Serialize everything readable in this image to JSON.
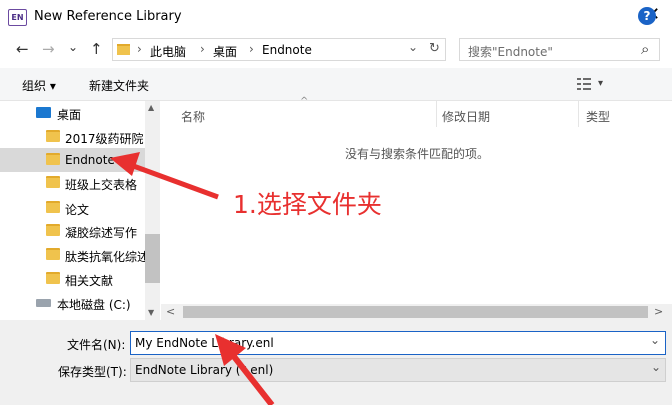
{
  "window": {
    "title": "New Reference Library",
    "app_icon": "EN",
    "close": "✕"
  },
  "address": {
    "back": "←",
    "forward": "→",
    "recent": "⌄",
    "up": "↑",
    "crumbs": [
      "此电脑",
      "桌面",
      "Endnote"
    ],
    "separator": "›",
    "dropdown": "⌄",
    "refresh": "↻"
  },
  "search": {
    "placeholder": "搜索\"Endnote\"",
    "icon": "⌕"
  },
  "toolbar": {
    "organize": "组织 ▾",
    "new_folder": "新建文件夹",
    "view_menu": "▾",
    "help": "?"
  },
  "nav": {
    "items": [
      {
        "label": "桌面",
        "selected": false,
        "type": "desktop"
      },
      {
        "label": "2017级药研院",
        "selected": false,
        "type": "folder"
      },
      {
        "label": "Endnote",
        "selected": true,
        "type": "folder"
      },
      {
        "label": "班级上交表格",
        "selected": false,
        "type": "folder"
      },
      {
        "label": "论文",
        "selected": false,
        "type": "folder"
      },
      {
        "label": "凝胶综述写作",
        "selected": false,
        "type": "folder"
      },
      {
        "label": "肽类抗氧化综述",
        "selected": false,
        "type": "folder"
      },
      {
        "label": "相关文献",
        "selected": false,
        "type": "folder"
      },
      {
        "label": "本地磁盘 (C:)",
        "selected": false,
        "type": "drive"
      }
    ],
    "scroll_up": "▲",
    "scroll_down": "▼"
  },
  "filelist": {
    "columns": [
      "名称",
      "修改日期",
      "类型"
    ],
    "sort_indicator": "^",
    "empty_message": "没有与搜索条件匹配的项。",
    "scroll_left": "<",
    "scroll_right": ">"
  },
  "form": {
    "filename_label": "文件名(N):",
    "filename_value": "My EndNote Library.enl",
    "savetype_label": "保存类型(T):",
    "savetype_value": "EndNote Library (*.enl)",
    "chevron": "⌄"
  },
  "annotation": {
    "text": "1.选择文件夹",
    "color": "#e8302f"
  },
  "colors": {
    "accent": "#1a63c6",
    "selection": "#d9d9d9",
    "folder": "#f0c34d",
    "annotation": "#e8302f"
  }
}
